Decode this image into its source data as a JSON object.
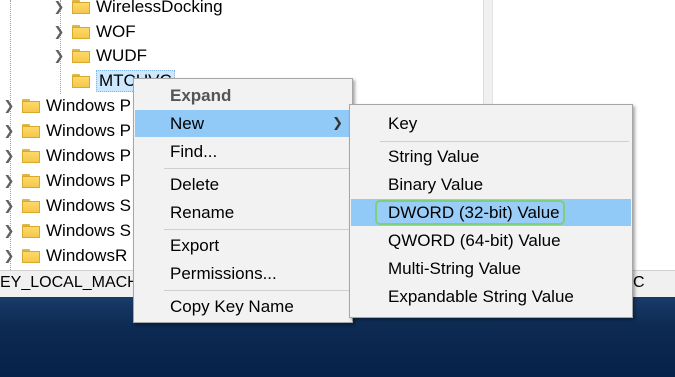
{
  "tree": {
    "items": [
      {
        "label": "WirelessDocking",
        "expandable": true
      },
      {
        "label": "WOF",
        "expandable": true
      },
      {
        "label": "WUDF",
        "expandable": true
      },
      {
        "label": "MTCUVC",
        "expandable": false,
        "selected": true
      },
      {
        "label": "Windows P",
        "expandable": true
      },
      {
        "label": "Windows P",
        "expandable": true
      },
      {
        "label": "Windows P",
        "expandable": true
      },
      {
        "label": "Windows P",
        "expandable": true
      },
      {
        "label": "Windows S",
        "expandable": true
      },
      {
        "label": "Windows S",
        "expandable": true
      },
      {
        "label": "WindowsR",
        "expandable": true
      }
    ]
  },
  "status_bar": {
    "path_left": "EY_LOCAL_MACH",
    "path_right": "C"
  },
  "context_menu": {
    "header": "Expand",
    "new": "New",
    "find": "Find...",
    "delete": "Delete",
    "rename": "Rename",
    "export": "Export",
    "permissions": "Permissions...",
    "copy_key_name": "Copy Key Name"
  },
  "new_submenu": {
    "key": "Key",
    "string_value": "String Value",
    "binary_value": "Binary Value",
    "dword_value": "DWORD (32-bit) Value",
    "qword_value": "QWORD (64-bit) Value",
    "multi_string_value": "Multi-String Value",
    "expandable_string_value": "Expandable String Value"
  },
  "colors": {
    "highlight": "#91c9f7",
    "annotation_ring": "#7dd07a",
    "folder": "#f3c74a"
  },
  "icons": {
    "expand": "chevron-right-icon",
    "folder": "folder-icon",
    "submenu": "submenu-arrow-icon"
  }
}
